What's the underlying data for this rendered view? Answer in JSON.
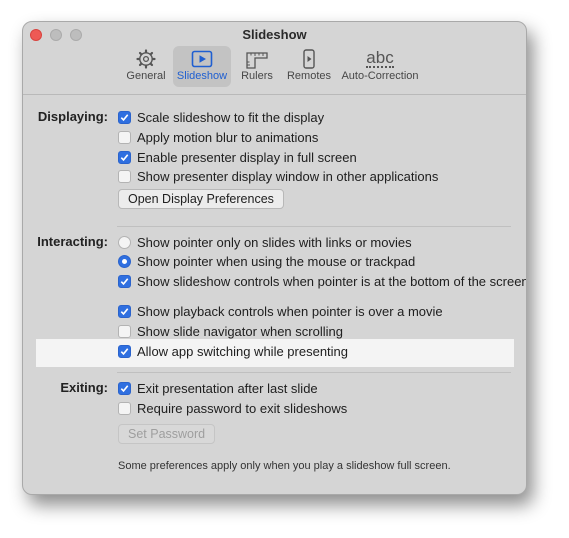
{
  "window": {
    "title": "Slideshow"
  },
  "toolbar": {
    "items": [
      {
        "label": "General",
        "icon": "gear-icon"
      },
      {
        "label": "Slideshow",
        "icon": "play-slide-icon",
        "selected": true
      },
      {
        "label": "Rulers",
        "icon": "ruler-icon"
      },
      {
        "label": "Remotes",
        "icon": "remote-phone-icon"
      },
      {
        "label": "Auto-Correction",
        "icon": "abc-icon",
        "icon_text": "abc"
      }
    ]
  },
  "displaying": {
    "label": "Displaying:",
    "options": [
      {
        "text": "Scale slideshow to fit the display",
        "checked": true
      },
      {
        "text": "Apply motion blur to animations",
        "checked": false
      },
      {
        "text": "Enable presenter display in full screen",
        "checked": true
      },
      {
        "text": "Show presenter display window in other applications",
        "checked": false
      }
    ],
    "button": "Open Display Preferences"
  },
  "interacting": {
    "label": "Interacting:",
    "radios": [
      {
        "text": "Show pointer only on slides with links or movies",
        "selected": false
      },
      {
        "text": "Show pointer when using the mouse or trackpad",
        "selected": true
      }
    ],
    "options": [
      {
        "text": "Show slideshow controls when pointer is at the bottom of the screen",
        "checked": true
      },
      {
        "text": "Show playback controls when pointer is over a movie",
        "checked": true
      },
      {
        "text": "Show slide navigator when scrolling",
        "checked": false
      },
      {
        "text": "Allow app switching while presenting",
        "checked": true
      }
    ]
  },
  "exiting": {
    "label": "Exiting:",
    "options": [
      {
        "text": "Exit presentation after last slide",
        "checked": true
      },
      {
        "text": "Require password to exit slideshows",
        "checked": false
      }
    ],
    "button": "Set Password"
  },
  "footnote": "Some preferences apply only when you play a slideshow full screen.",
  "colors": {
    "accent": "#2f6fe0",
    "close": "#ee5a55",
    "window": "#d5d5d5"
  }
}
